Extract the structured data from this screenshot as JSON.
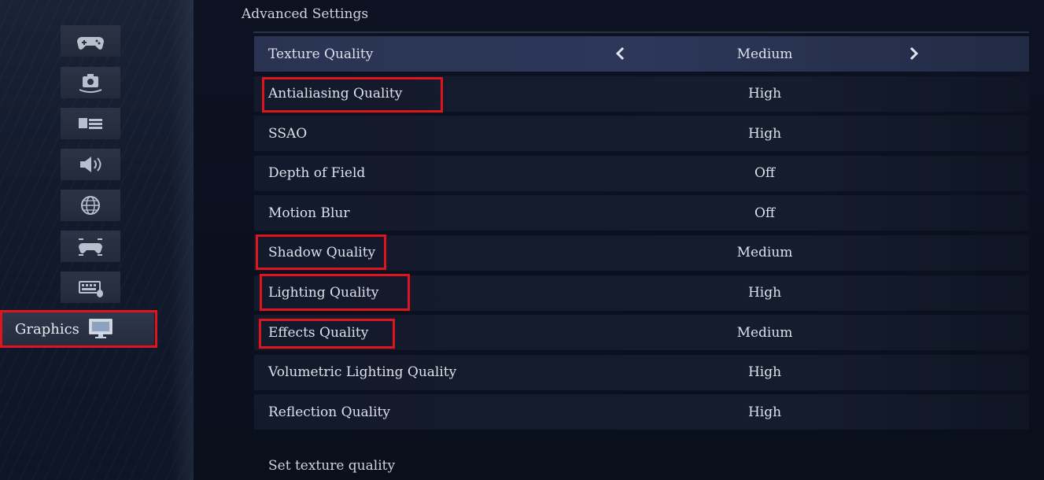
{
  "sidebar": {
    "items": [
      {
        "icon": "gamepad-icon"
      },
      {
        "icon": "camera-icon"
      },
      {
        "icon": "display-list-icon"
      },
      {
        "icon": "speaker-icon"
      },
      {
        "icon": "globe-icon"
      },
      {
        "icon": "controller-settings-icon"
      },
      {
        "icon": "keyboard-mouse-icon"
      }
    ],
    "active": {
      "label": "Graphics",
      "icon": "monitor-icon"
    }
  },
  "main": {
    "section_title": "Advanced Settings",
    "rows": [
      {
        "name": "Texture Quality",
        "value": "Medium",
        "selected": true
      },
      {
        "name": "Antialiasing Quality",
        "value": "High"
      },
      {
        "name": "SSAO",
        "value": "High"
      },
      {
        "name": "Depth of Field",
        "value": "Off"
      },
      {
        "name": "Motion Blur",
        "value": "Off"
      },
      {
        "name": "Shadow Quality",
        "value": "Medium"
      },
      {
        "name": "Lighting Quality",
        "value": "High"
      },
      {
        "name": "Effects Quality",
        "value": "Medium"
      },
      {
        "name": "Volumetric Lighting Quality",
        "value": "High"
      },
      {
        "name": "Reflection Quality",
        "value": "High"
      }
    ],
    "hint": "Set texture quality"
  },
  "colors": {
    "highlight": "#e0141c",
    "selected_row": "#2c375a"
  }
}
